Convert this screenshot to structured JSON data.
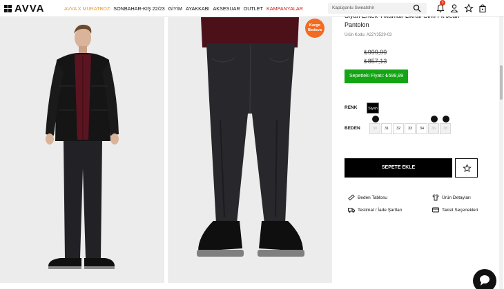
{
  "header": {
    "logo_text": "AVVA",
    "nav": [
      {
        "label": "AVVA X MURATBOZ",
        "color": "#f29a2e"
      },
      {
        "label": "SONBAHAR-KIŞ 22/23",
        "color": "#111111"
      },
      {
        "label": "GİYİM",
        "color": "#111111"
      },
      {
        "label": "AYAKKABI",
        "color": "#111111"
      },
      {
        "label": "AKSESUAR",
        "color": "#111111"
      },
      {
        "label": "OUTLET",
        "color": "#111111"
      },
      {
        "label": "KAMPANYALAR",
        "color": "#d11b1b"
      }
    ],
    "search_placeholder": "Kapüşonlu Sweatshir",
    "notification_count": "3"
  },
  "images": {
    "cargo_badge": "Kargo Bedava"
  },
  "product": {
    "name": "Siyah Erkek Yıkamalı Likralı Slim Fit Jean Pantolon",
    "code": "Ürün Kodu: A22Y3529-03",
    "old_price_1": "₺999,99",
    "old_price_2": "₺857,13",
    "basket_price": "Sepetteki Fiyatı: ₺599,99",
    "color_label": "RENK",
    "color_value": "Siyah",
    "size_label": "BEDEN",
    "sizes": [
      {
        "label": "30",
        "available": false,
        "bell": true
      },
      {
        "label": "31",
        "available": true,
        "bell": false
      },
      {
        "label": "32",
        "available": true,
        "bell": false
      },
      {
        "label": "33",
        "available": true,
        "bell": false
      },
      {
        "label": "34",
        "available": true,
        "bell": false
      },
      {
        "label": "36",
        "available": false,
        "bell": true
      },
      {
        "label": "38",
        "available": false,
        "bell": true
      }
    ],
    "add_to_cart": "SEPETE EKLE",
    "links": {
      "size_chart": "Beden Tablosu",
      "product_details": "Ürün Detayları",
      "delivery_returns": "Teslimat / İade Şartları",
      "installments": "Taksit Seçenekleri"
    }
  }
}
